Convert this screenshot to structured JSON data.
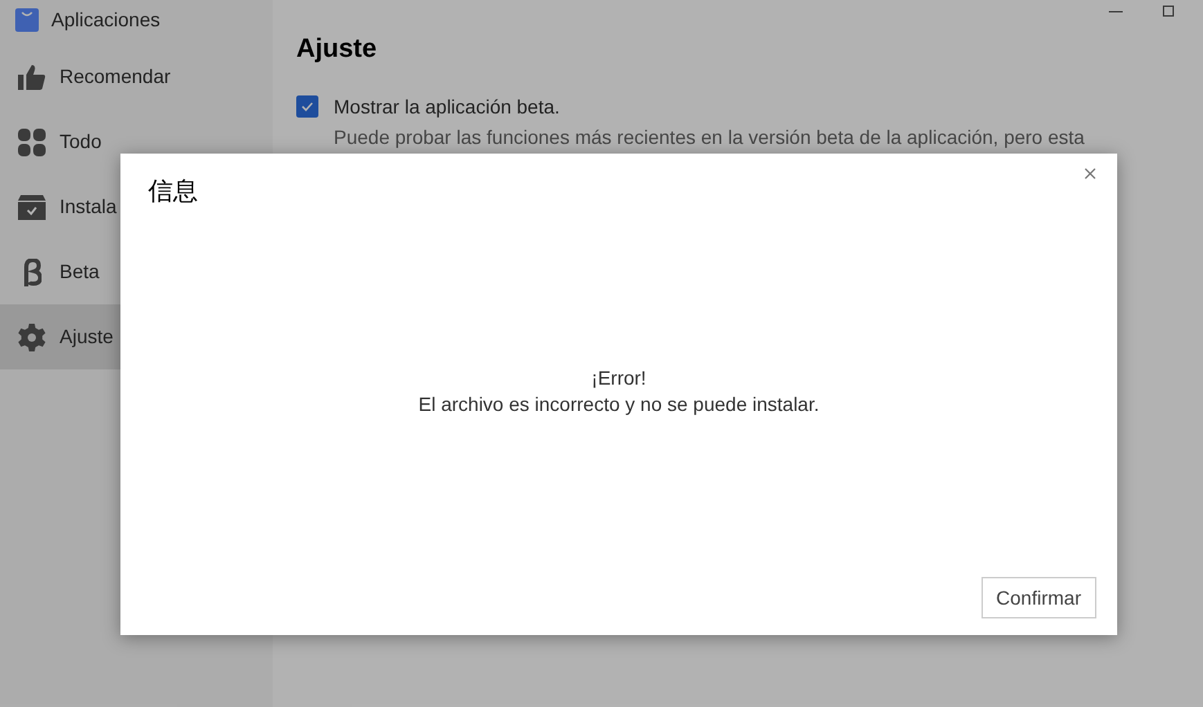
{
  "app": {
    "title": "Aplicaciones"
  },
  "sidebar": {
    "items": [
      {
        "kind": "thumb",
        "label": "Recomendar",
        "selected": false
      },
      {
        "kind": "grid",
        "label": "Todo",
        "selected": false
      },
      {
        "kind": "box",
        "label": "Instala",
        "selected": false
      },
      {
        "kind": "beta",
        "label": "Beta",
        "selected": false
      },
      {
        "kind": "gear",
        "label": "Ajuste",
        "selected": true
      }
    ]
  },
  "settings": {
    "heading": "Ajuste",
    "option": {
      "label": "Mostrar la aplicación beta.",
      "checked": true,
      "description": "Puede probar las funciones más recientes en la versión beta de la aplicación, pero esta"
    }
  },
  "dialog": {
    "title": "信息",
    "message": [
      "¡Error!",
      "El archivo es incorrecto y no se puede instalar."
    ],
    "button": "Confirmar"
  }
}
